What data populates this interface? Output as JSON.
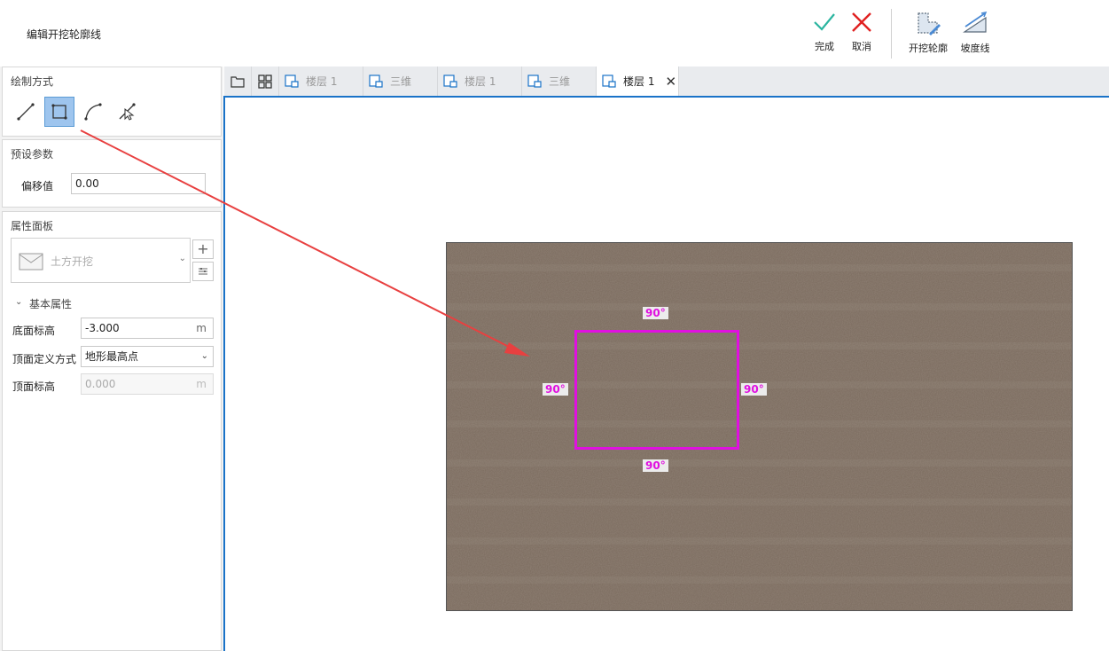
{
  "header": {
    "title": "编辑开挖轮廓线",
    "buttons": {
      "finish": "完成",
      "cancel": "取消",
      "excavation_outline": "开挖轮廓",
      "slope_line": "坡度线"
    }
  },
  "left_panel": {
    "draw_mode": {
      "title": "绘制方式",
      "tools": [
        "line-tool-icon",
        "rectangle-tool-icon",
        "arc-tool-icon",
        "pick-tool-icon"
      ],
      "active_tool": "rectangle-tool-icon"
    },
    "preset": {
      "title": "预设参数",
      "offset_label": "偏移值",
      "offset_value": "0.00"
    },
    "properties": {
      "title": "属性面板",
      "type_name": "土方开挖",
      "group_title": "基本属性",
      "bottom_elev_label": "底面标高",
      "bottom_elev_value": "-3.000",
      "bottom_elev_unit": "m",
      "top_def_label": "顶面定义方式",
      "top_def_value": "地形最高点",
      "top_elev_label": "顶面标高",
      "top_elev_value": "0.000",
      "top_elev_unit": "m"
    }
  },
  "tabs": [
    {
      "label": "楼层 1",
      "active": false
    },
    {
      "label": "三维",
      "active": false
    },
    {
      "label": "楼层 1",
      "active": false
    },
    {
      "label": "三维",
      "active": false
    },
    {
      "label": "楼层 1",
      "active": true
    }
  ],
  "canvas": {
    "angle_labels": [
      "90°",
      "90°",
      "90°",
      "90°"
    ]
  },
  "colors": {
    "accent_blue": "#1a73c8",
    "outline_magenta": "#e010e0",
    "arrow_red": "#e84040",
    "terrain_brown": "#7a6a5d",
    "finish_green": "#2bb5a0",
    "cancel_red": "#e02020"
  }
}
